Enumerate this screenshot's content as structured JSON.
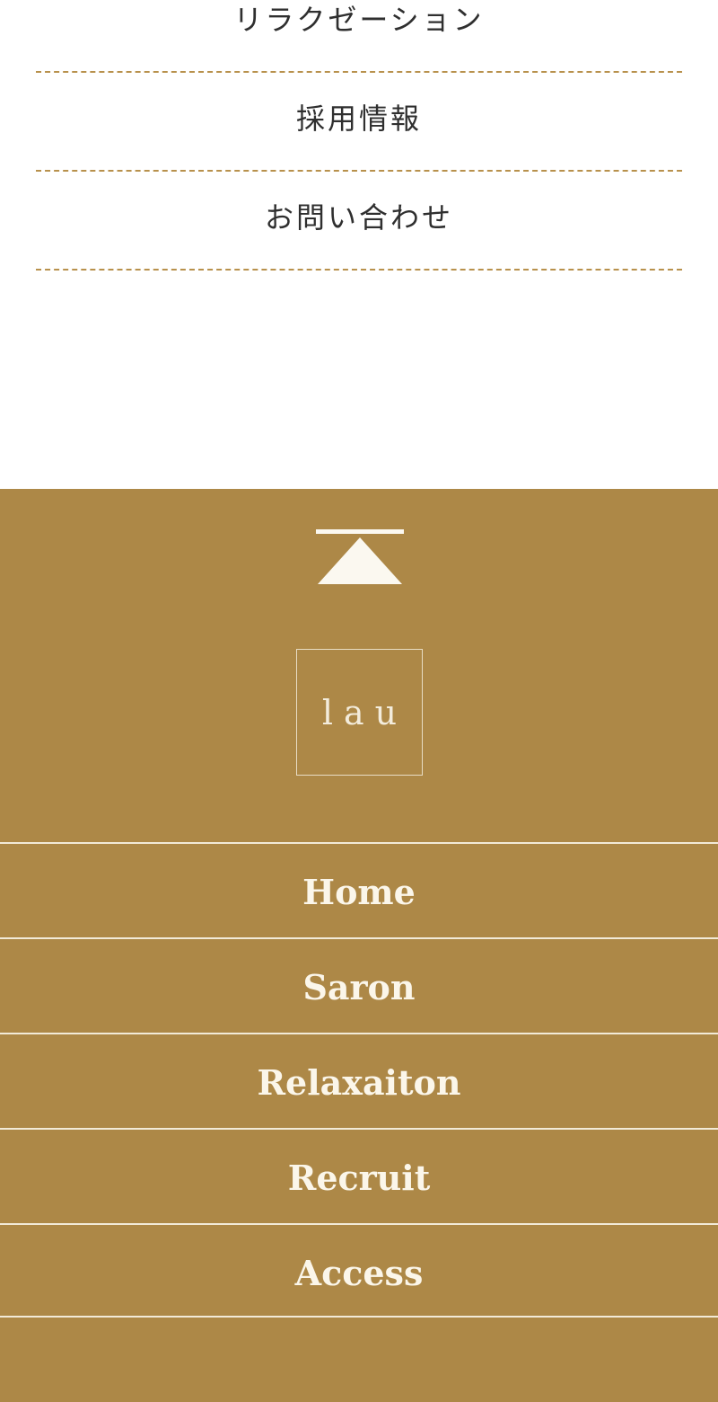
{
  "menu": {
    "items": [
      {
        "label": "リラクゼーション"
      },
      {
        "label": "採用情報"
      },
      {
        "label": "お問い合わせ"
      }
    ]
  },
  "footer": {
    "logo_text": "lau",
    "nav": [
      {
        "label": "Home"
      },
      {
        "label": "Saron"
      },
      {
        "label": "Relaxaiton"
      },
      {
        "label": "Recruit"
      },
      {
        "label": "Access"
      }
    ]
  },
  "colors": {
    "footer_bg": "#ad8847",
    "divider_dash": "#b8914c",
    "footer_text": "#fbf6ea"
  }
}
